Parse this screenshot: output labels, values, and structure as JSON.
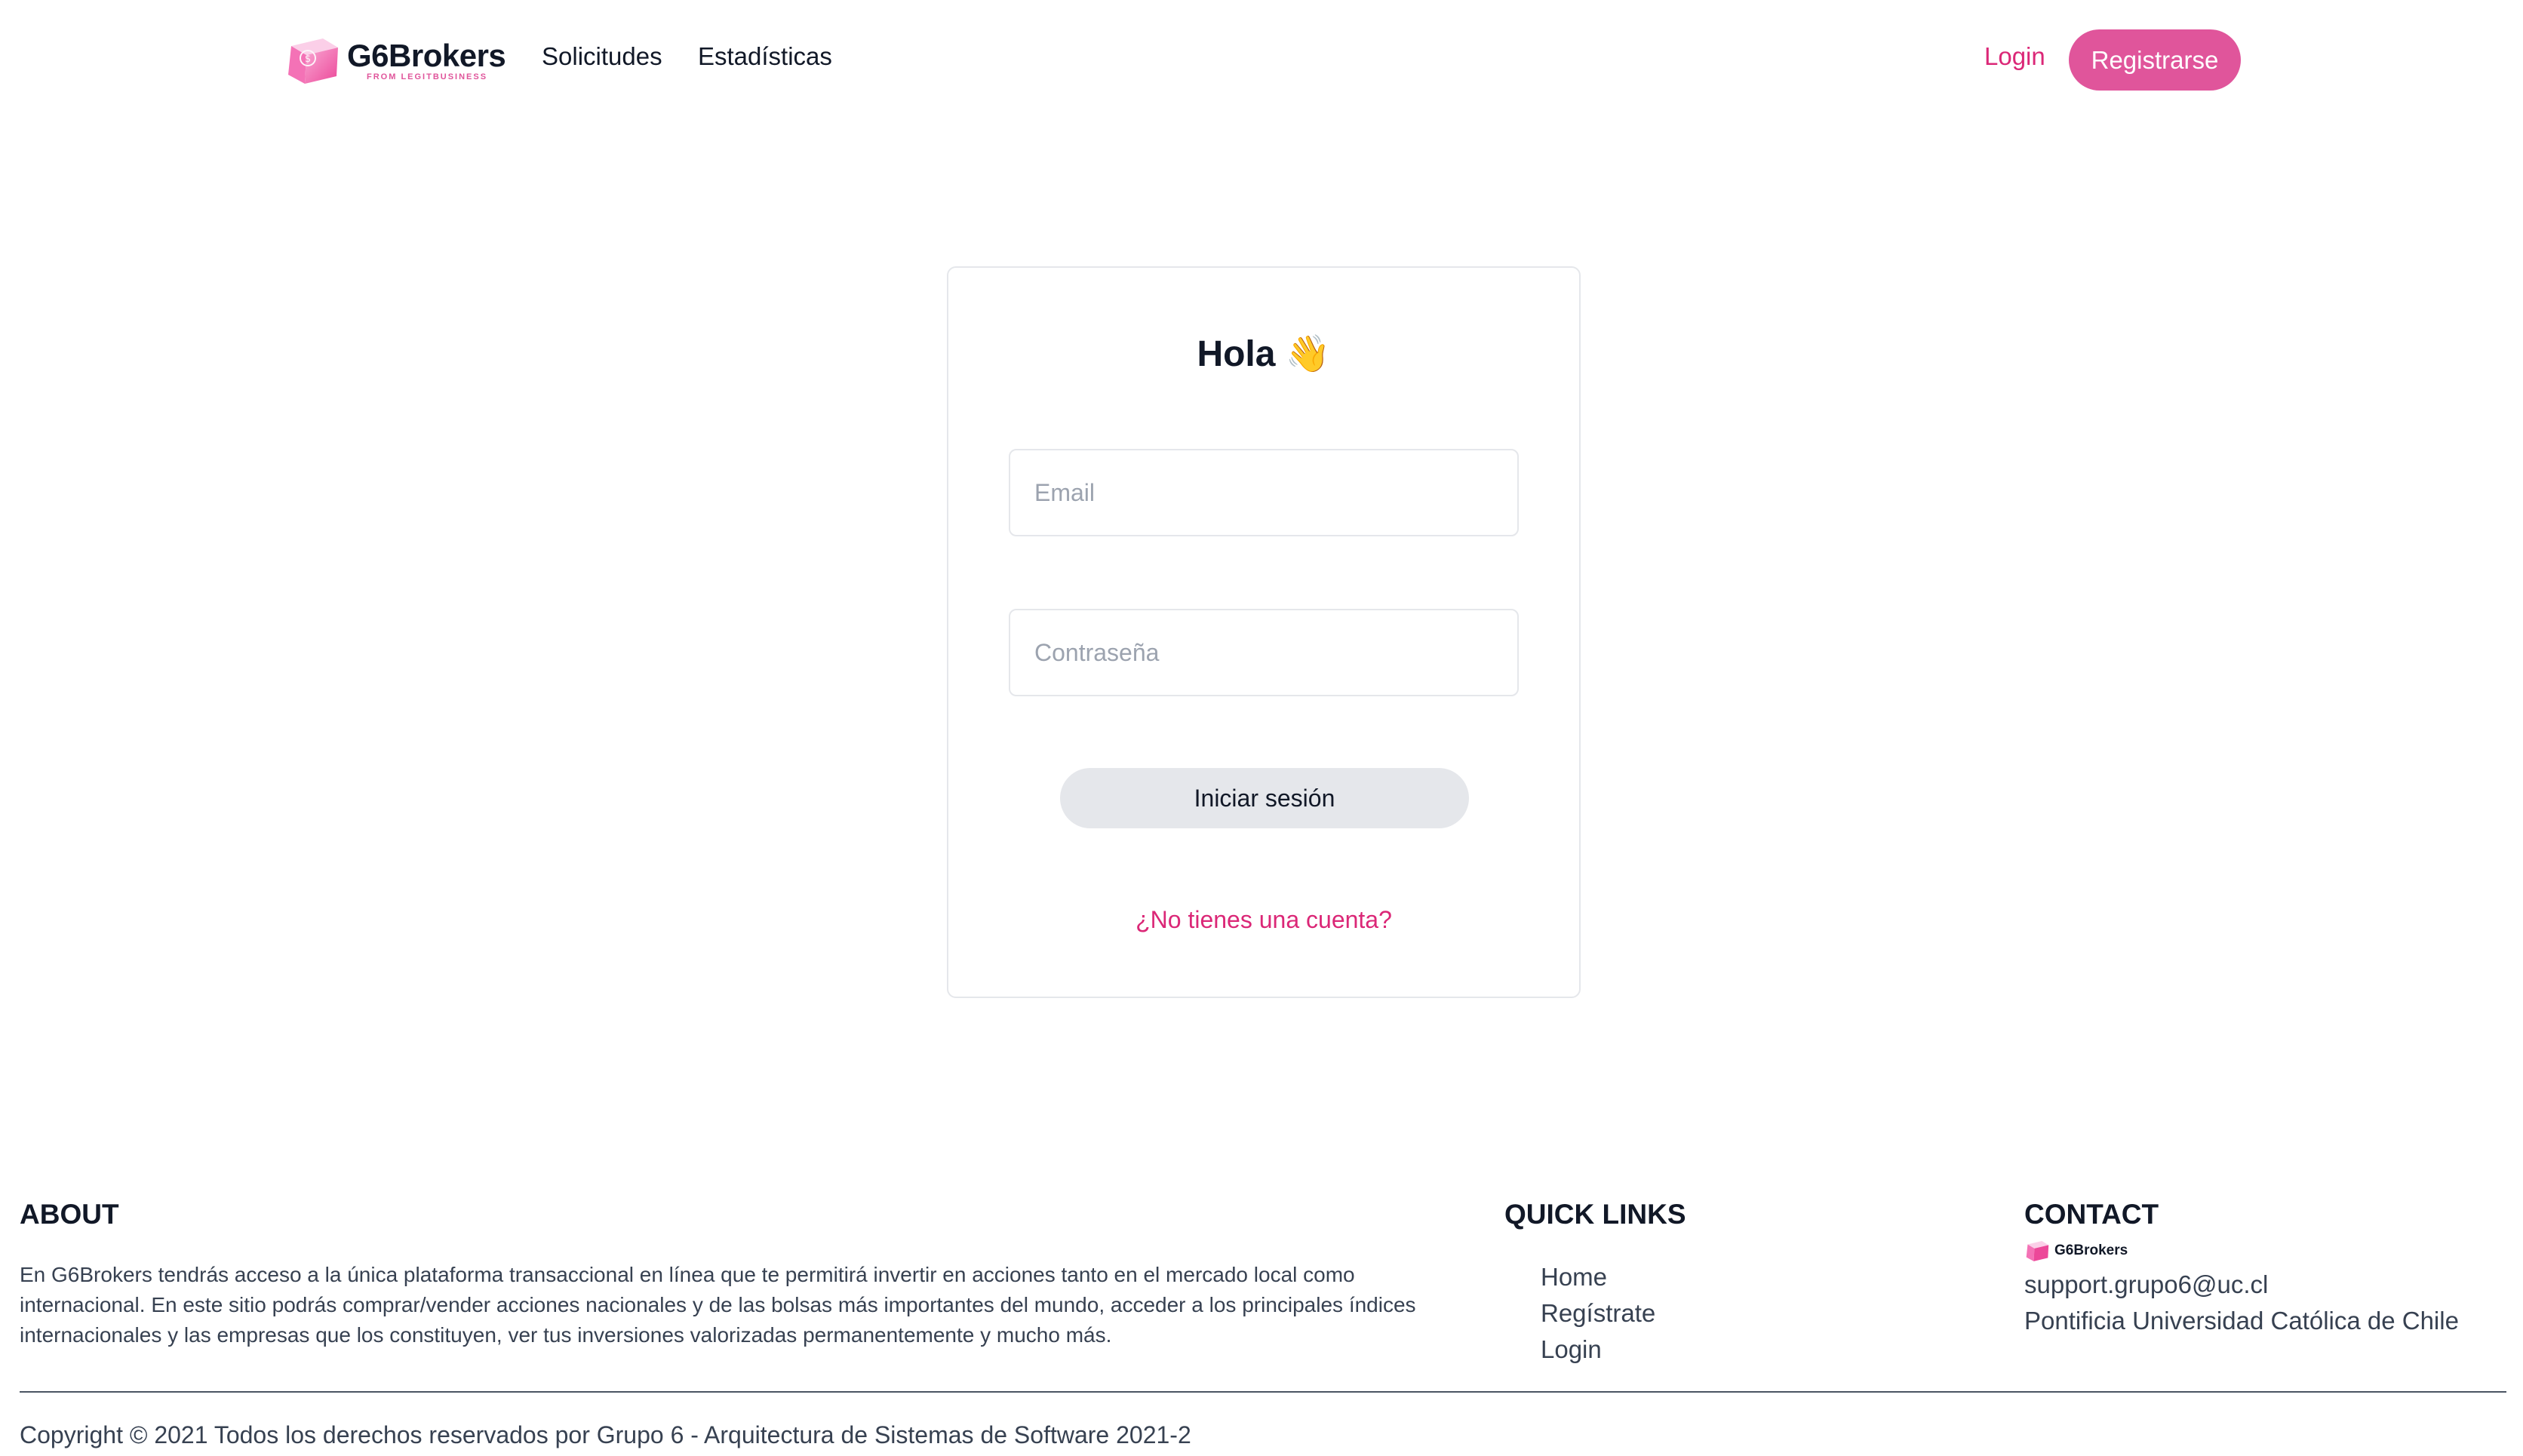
{
  "brand": {
    "name": "G6Brokers",
    "tagline": "FROM LEGITBUSINESS",
    "color": "#e0559b"
  },
  "nav": {
    "links": [
      "Solicitudes",
      "Estadísticas"
    ],
    "login": "Login",
    "register": "Registrarse"
  },
  "login_form": {
    "title": "Hola 👋",
    "email_placeholder": "Email",
    "password_placeholder": "Contraseña",
    "submit": "Iniciar sesión",
    "no_account": "¿No tienes una cuenta?"
  },
  "footer": {
    "about": {
      "heading": "ABOUT",
      "text": "En G6Brokers tendrás acceso a la única plataforma transaccional en línea que te permitirá invertir en acciones tanto en el mercado local como internacional. En este sitio podrás comprar/vender acciones nacionales y de las bolsas más importantes del mundo, acceder a los principales índices internacionales y las empresas que los constituyen, ver tus inversiones valorizadas permanentemente y mucho más."
    },
    "quick_links": {
      "heading": "QUICK LINKS",
      "items": [
        "Home",
        "Regístrate",
        "Login"
      ]
    },
    "contact": {
      "heading": "CONTACT",
      "logo_text": "G6Brokers",
      "email": "support.grupo6@uc.cl",
      "org": "Pontificia Universidad Católica de Chile"
    },
    "copyright": "Copyright © 2021 Todos los derechos reservados por Grupo 6 - Arquitectura de Sistemas de Software 2021-2"
  },
  "icons": {
    "logo": "g6brokers-cube-logo",
    "wave": "waving-hand-emoji"
  }
}
